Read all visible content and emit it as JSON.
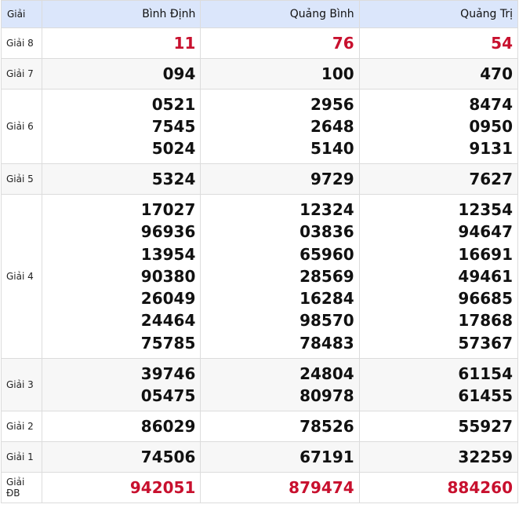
{
  "header": {
    "label": "Giải",
    "provinces": [
      "Bình Định",
      "Quảng Bình",
      "Quảng Trị"
    ]
  },
  "prizes": [
    {
      "label": "Giải 8",
      "values": [
        [
          "11"
        ],
        [
          "76"
        ],
        [
          "54"
        ]
      ]
    },
    {
      "label": "Giải 7",
      "values": [
        [
          "094"
        ],
        [
          "100"
        ],
        [
          "470"
        ]
      ]
    },
    {
      "label": "Giải 6",
      "values": [
        [
          "0521",
          "7545",
          "5024"
        ],
        [
          "2956",
          "2648",
          "5140"
        ],
        [
          "8474",
          "0950",
          "9131"
        ]
      ]
    },
    {
      "label": "Giải 5",
      "values": [
        [
          "5324"
        ],
        [
          "9729"
        ],
        [
          "7627"
        ]
      ]
    },
    {
      "label": "Giải 4",
      "values": [
        [
          "17027",
          "96936",
          "13954",
          "90380",
          "26049",
          "24464",
          "75785"
        ],
        [
          "12324",
          "03836",
          "65960",
          "28569",
          "16284",
          "98570",
          "78483"
        ],
        [
          "12354",
          "94647",
          "16691",
          "49461",
          "96685",
          "17868",
          "57367"
        ]
      ]
    },
    {
      "label": "Giải 3",
      "values": [
        [
          "39746",
          "05475"
        ],
        [
          "24804",
          "80978"
        ],
        [
          "61154",
          "61455"
        ]
      ]
    },
    {
      "label": "Giải 2",
      "values": [
        [
          "86029"
        ],
        [
          "78526"
        ],
        [
          "55927"
        ]
      ]
    },
    {
      "label": "Giải 1",
      "values": [
        [
          "74506"
        ],
        [
          "67191"
        ],
        [
          "32259"
        ]
      ]
    },
    {
      "label": "Giải ĐB",
      "values": [
        [
          "942051"
        ],
        [
          "879474"
        ],
        [
          "884260"
        ]
      ]
    }
  ],
  "colors": {
    "header_bg": "#dbe6fb",
    "highlight": "#c8102e",
    "text": "#111111",
    "row_alt": "#f7f7f7"
  }
}
